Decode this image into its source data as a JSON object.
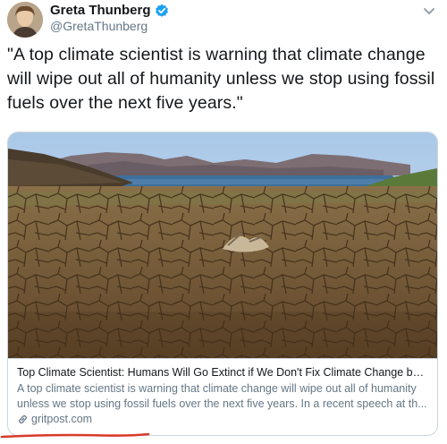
{
  "tweet": {
    "author_name": "Greta Thunberg",
    "author_handle": "@GretaThunberg",
    "text": "\"A top climate scientist is warning that climate change will wipe out all of humanity unless we stop using fossil fuels over the next five years.\""
  },
  "card": {
    "title": "Top Climate Scientist: Humans Will Go Extinct if We Don't Fix Climate Change by ...",
    "description": "A top climate scientist is warning that climate change will wipe out all of humanity unless we stop using fossil fuels over the next five years. In a recent speech at th...",
    "domain": "gritpost.com"
  },
  "icons": {
    "verified": "verified-badge-icon",
    "menu": "chevron-down-icon",
    "link": "link-icon"
  },
  "colors": {
    "verified_blue": "#1da1f2",
    "secondary_text": "#657786",
    "card_border": "#ccd6dd",
    "annotation_red": "#d83a2b"
  }
}
